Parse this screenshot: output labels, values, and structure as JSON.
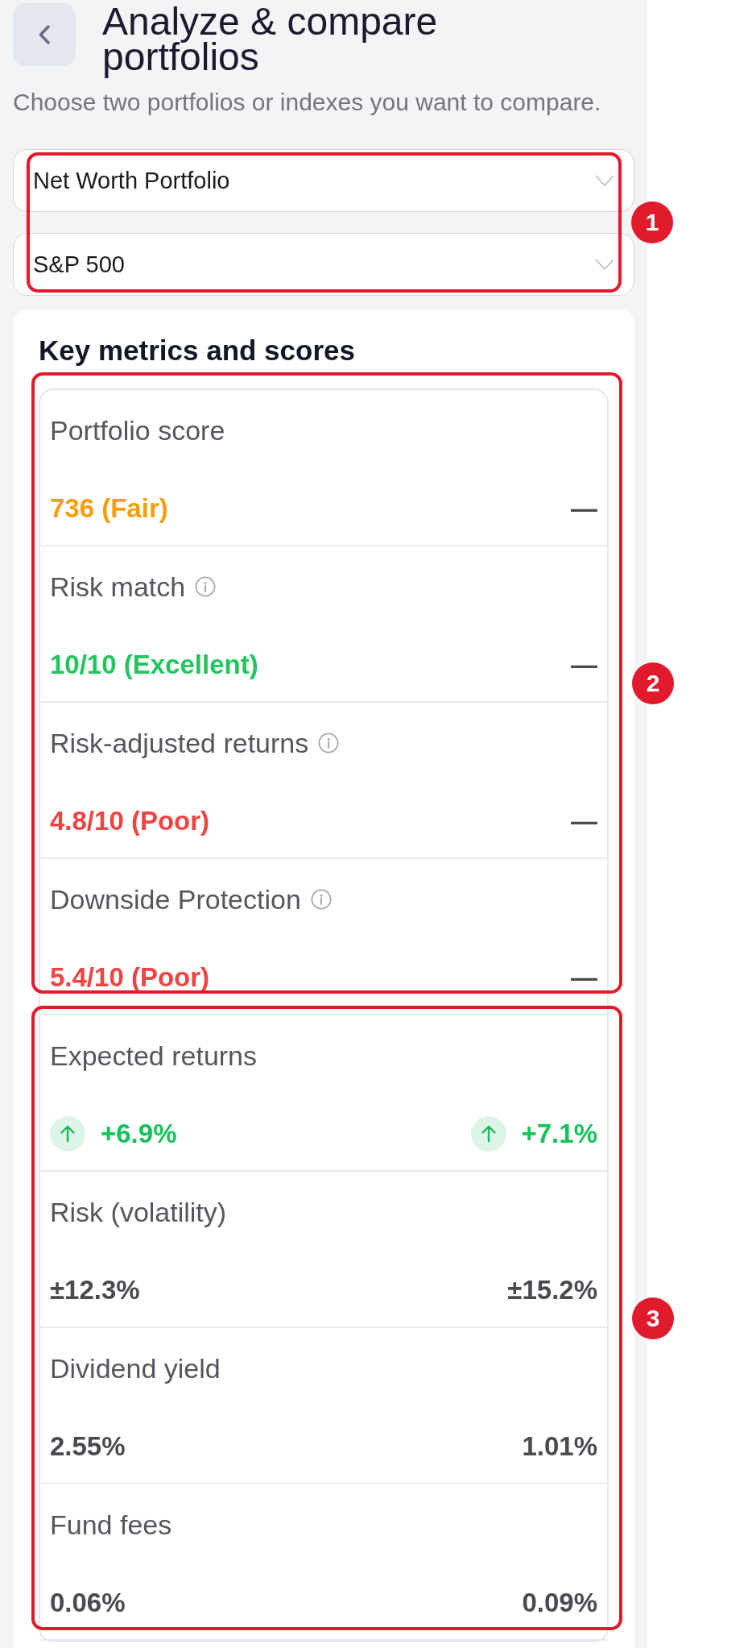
{
  "header": {
    "title": "Analyze & compare portfolios",
    "subtitle": "Choose two portfolios or indexes you want to compare."
  },
  "selectors": {
    "callout": "1",
    "dropdowns": [
      {
        "value": "Net Worth Portfolio"
      },
      {
        "value": "S&P 500"
      }
    ]
  },
  "metrics_card": {
    "title": "Key metrics and scores",
    "groups": [
      {
        "callout": "2",
        "metrics": [
          {
            "label": "Portfolio score",
            "info": false,
            "values": [
              {
                "kind": "plain",
                "text": "736 (Fair)",
                "color": "#f59e0b"
              },
              {
                "kind": "plain",
                "text": "—"
              }
            ]
          },
          {
            "label": "Risk match",
            "info": true,
            "values": [
              {
                "kind": "plain",
                "text": "10/10 (Excellent)",
                "color": "#22c55e"
              },
              {
                "kind": "plain",
                "text": "—"
              }
            ]
          },
          {
            "label": "Risk-adjusted returns",
            "info": true,
            "values": [
              {
                "kind": "plain",
                "text": "4.8/10 (Poor)",
                "color": "#ef4444"
              },
              {
                "kind": "plain",
                "text": "—"
              }
            ]
          },
          {
            "label": "Downside Protection",
            "info": true,
            "values": [
              {
                "kind": "plain",
                "text": "5.4/10 (Poor)",
                "color": "#ef4444"
              },
              {
                "kind": "plain",
                "text": "—"
              }
            ]
          }
        ]
      },
      {
        "callout": "3",
        "metrics": [
          {
            "label": "Expected returns",
            "info": false,
            "values": [
              {
                "kind": "rising",
                "text": "+6.9%",
                "color": "#16c25a"
              },
              {
                "kind": "rising",
                "text": "+7.1%",
                "color": "#16c25a"
              }
            ]
          },
          {
            "label": "Risk (volatility)",
            "info": false,
            "values": [
              {
                "kind": "plain",
                "text": "±12.3%"
              },
              {
                "kind": "plain",
                "text": "±15.2%"
              }
            ]
          },
          {
            "label": "Dividend yield",
            "info": false,
            "values": [
              {
                "kind": "plain",
                "text": "2.55%"
              },
              {
                "kind": "plain",
                "text": "1.01%"
              }
            ]
          },
          {
            "label": "Fund fees",
            "info": false,
            "values": [
              {
                "kind": "plain",
                "text": "0.06%"
              },
              {
                "kind": "plain",
                "text": "0.09%"
              }
            ]
          }
        ]
      }
    ]
  }
}
